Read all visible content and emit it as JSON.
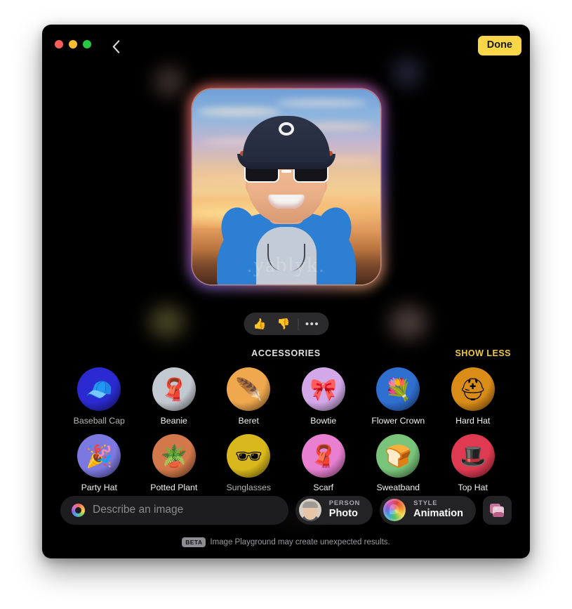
{
  "window": {
    "titlebar": {
      "traffic_lights": [
        "close",
        "minimize",
        "zoom"
      ],
      "back_label": "Back",
      "done_label": "Done",
      "done_color": "#f9d648"
    }
  },
  "preview": {
    "alt": "Generated cartoon portrait of a smiling man wearing a navy baseball cap, black sunglasses and a blue hoodie against a sunset sky",
    "watermark": ".yablyk."
  },
  "feedback": {
    "thumbs_up": "👍",
    "thumbs_down": "👎",
    "more": "•••"
  },
  "accessories_section": {
    "title": "ACCESSORIES",
    "show_less": "SHOW LESS",
    "show_less_color": "#efc84a",
    "items": [
      {
        "label": "Baseball Cap",
        "glyph": "🧢",
        "bg": "#2a2ad0",
        "dim": true
      },
      {
        "label": "Beanie",
        "glyph": "🧣",
        "bg": "#c3c9d1",
        "dim": false
      },
      {
        "label": "Beret",
        "glyph": "🪶",
        "bg": "#f0a84e",
        "dim": false
      },
      {
        "label": "Bowtie",
        "glyph": "🎀",
        "bg": "#d2a8e8",
        "dim": false
      },
      {
        "label": "Flower Crown",
        "glyph": "💐",
        "bg": "#2f6fd0",
        "dim": false
      },
      {
        "label": "Hard Hat",
        "glyph": "⛑",
        "bg": "#d98c18",
        "dim": false
      },
      {
        "label": "Party Hat",
        "glyph": "🎉",
        "bg": "#7b79e0",
        "dim": false
      },
      {
        "label": "Potted Plant",
        "glyph": "🪴",
        "bg": "#d2784a",
        "dim": false
      },
      {
        "label": "Sunglasses",
        "glyph": "🕶",
        "bg": "#d8b81c",
        "dim": true
      },
      {
        "label": "Scarf",
        "glyph": "🧣",
        "bg": "#e87fd0",
        "dim": false
      },
      {
        "label": "Sweatband",
        "glyph": "🍞",
        "bg": "#79c47a",
        "dim": false
      },
      {
        "label": "Top Hat",
        "glyph": "🎩",
        "bg": "#e03a52",
        "dim": false
      }
    ]
  },
  "bottom_bar": {
    "describe_placeholder": "Describe an image",
    "person_chip": {
      "kicker": "PERSON",
      "value": "Photo"
    },
    "style_chip": {
      "kicker": "STYLE",
      "value": "Animation"
    },
    "photo_picker_label": "Choose photo"
  },
  "footer": {
    "badge": "BETA",
    "text": "Image Playground may create unexpected results."
  }
}
